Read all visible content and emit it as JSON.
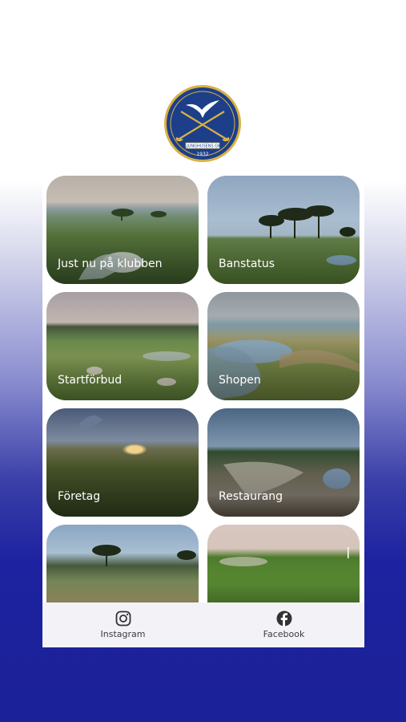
{
  "logo": {
    "text": "LJUNGHUSENS GK",
    "year": "1932"
  },
  "tiles": [
    {
      "label": "Just nu på klubben"
    },
    {
      "label": "Banstatus"
    },
    {
      "label": "Startförbud"
    },
    {
      "label": "Shopen"
    },
    {
      "label": "Företag"
    },
    {
      "label": "Restaurang"
    },
    {
      "label": ""
    },
    {
      "label": ""
    }
  ],
  "tabbar": {
    "instagram": {
      "label": "Instagram",
      "icon": "instagram-icon"
    },
    "facebook": {
      "label": "Facebook",
      "icon": "facebook-icon"
    }
  },
  "colors": {
    "logo_blue": "#1d3f8a",
    "logo_gold": "#d9b144",
    "background_top": "#ffffff",
    "background_bottom": "#1b2197",
    "tabbar": "#f2f2f7"
  }
}
